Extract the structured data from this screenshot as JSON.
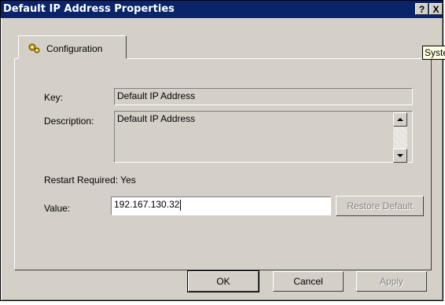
{
  "window": {
    "title": "Default IP Address Properties",
    "help_label": "?",
    "close_label": "X"
  },
  "tab": {
    "label": "Configuration"
  },
  "tooltip": {
    "text": "Syste"
  },
  "form": {
    "key_label": "Key:",
    "key_value": "Default IP Address",
    "description_label": "Description:",
    "description_value": "Default IP Address",
    "restart_label": "Restart Required:",
    "restart_value": "Yes",
    "value_label": "Value:",
    "value_value": "192.167.130.32",
    "restore_default_label": "Restore Default"
  },
  "buttons": {
    "ok_label": "OK",
    "cancel_label": "Cancel",
    "apply_label": "Apply"
  }
}
